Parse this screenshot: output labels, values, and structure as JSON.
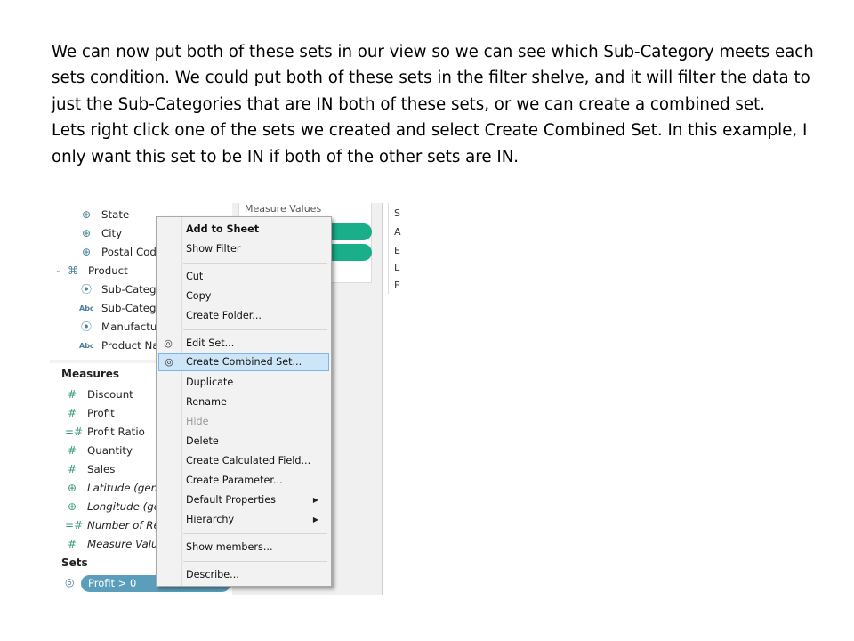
{
  "slide": {
    "paragraph_1": "We can now put both of these sets in our view so we can see which Sub-Category meets each sets condition. We could put both of these sets in the filter shelve, and it will filter the data to just the Sub-Categories that are IN both of these sets, or we can create a combined set.",
    "paragraph_2": "Lets right click one of the sets we created and select Create Combined Set. In this example, I only want this set to be IN if both of the other sets are IN."
  },
  "data_pane": {
    "dimensions": [
      {
        "label": "State",
        "icon": "globe-icon"
      },
      {
        "label": "City",
        "icon": "globe-icon"
      },
      {
        "label": "Postal Cod",
        "icon": "globe-icon"
      },
      {
        "label": "Product",
        "icon": "hierarchy-icon"
      },
      {
        "label": "Sub-Categ",
        "icon": "paperclip-icon"
      },
      {
        "label": "Sub-Categ",
        "icon": "abc-icon",
        "icon_text": "Abc"
      },
      {
        "label": "Manufactu",
        "icon": "paperclip-icon"
      },
      {
        "label": "Product Na",
        "icon": "abc-icon",
        "icon_text": "Abc"
      }
    ],
    "measures_header": "Measures",
    "measures": [
      {
        "label": "Discount",
        "icon": "hash-icon"
      },
      {
        "label": "Profit",
        "icon": "hash-icon"
      },
      {
        "label": "Profit Ratio",
        "icon": "calc-hash-icon"
      },
      {
        "label": "Quantity",
        "icon": "hash-icon"
      },
      {
        "label": "Sales",
        "icon": "hash-icon"
      },
      {
        "label": "Latitude (gen",
        "icon": "globe-icon"
      },
      {
        "label": "Longitude (ge",
        "icon": "globe-icon"
      },
      {
        "label": "Number of Re",
        "icon": "calc-hash-icon"
      },
      {
        "label": "Measure Valu",
        "icon": "hash-icon"
      }
    ],
    "sets_header": "Sets",
    "set_pill": "Profit > 0"
  },
  "view": {
    "measure_values_label": "Measure Values",
    "legend_letters": [
      "S",
      "A",
      "E",
      "L",
      "F"
    ]
  },
  "context_menu": {
    "items": [
      {
        "label": "Add to Sheet",
        "bold": true
      },
      {
        "label": "Show Filter"
      },
      {
        "label": "Cut"
      },
      {
        "label": "Copy"
      },
      {
        "label": "Create Folder..."
      },
      {
        "label": "Edit Set...",
        "icon": "set-icon"
      },
      {
        "label": "Create Combined Set...",
        "icon": "set-icon",
        "highlighted": true
      },
      {
        "label": "Duplicate"
      },
      {
        "label": "Rename"
      },
      {
        "label": "Hide",
        "disabled": true
      },
      {
        "label": "Delete"
      },
      {
        "label": "Create Calculated Field..."
      },
      {
        "label": "Create Parameter..."
      },
      {
        "label": "Default Properties",
        "submenu": true
      },
      {
        "label": "Hierarchy",
        "submenu": true
      },
      {
        "label": "Show members..."
      },
      {
        "label": "Describe..."
      }
    ]
  },
  "colors": {
    "highlight": "#cde6f7",
    "green_pill": "#1aae8a",
    "set_pill": "#5b9ebc"
  }
}
